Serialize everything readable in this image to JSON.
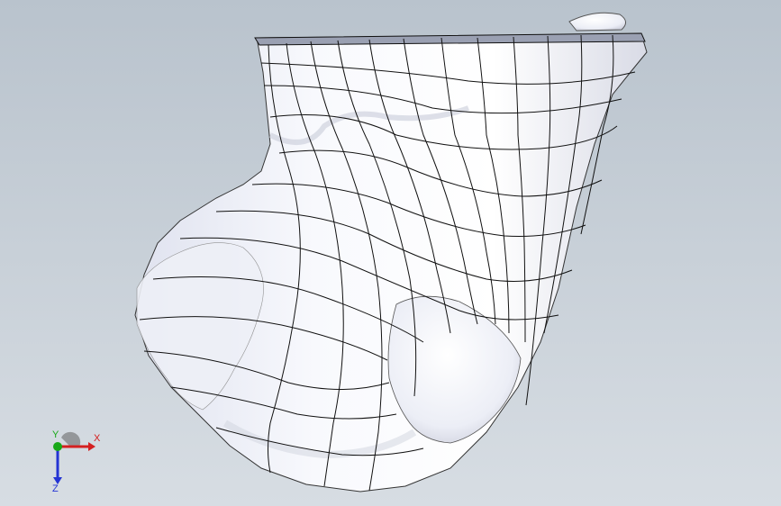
{
  "viewport": {
    "background_top": "#b9c3cd",
    "background_bottom": "#d7dde3"
  },
  "model": {
    "surface_color": "#f4f5fb",
    "edge_color": "#111111"
  },
  "triad": {
    "x_label": "X",
    "y_label": "Y",
    "z_label": "Z",
    "x_color": "#d42020",
    "y_color": "#18a818",
    "z_color": "#2434d4"
  }
}
